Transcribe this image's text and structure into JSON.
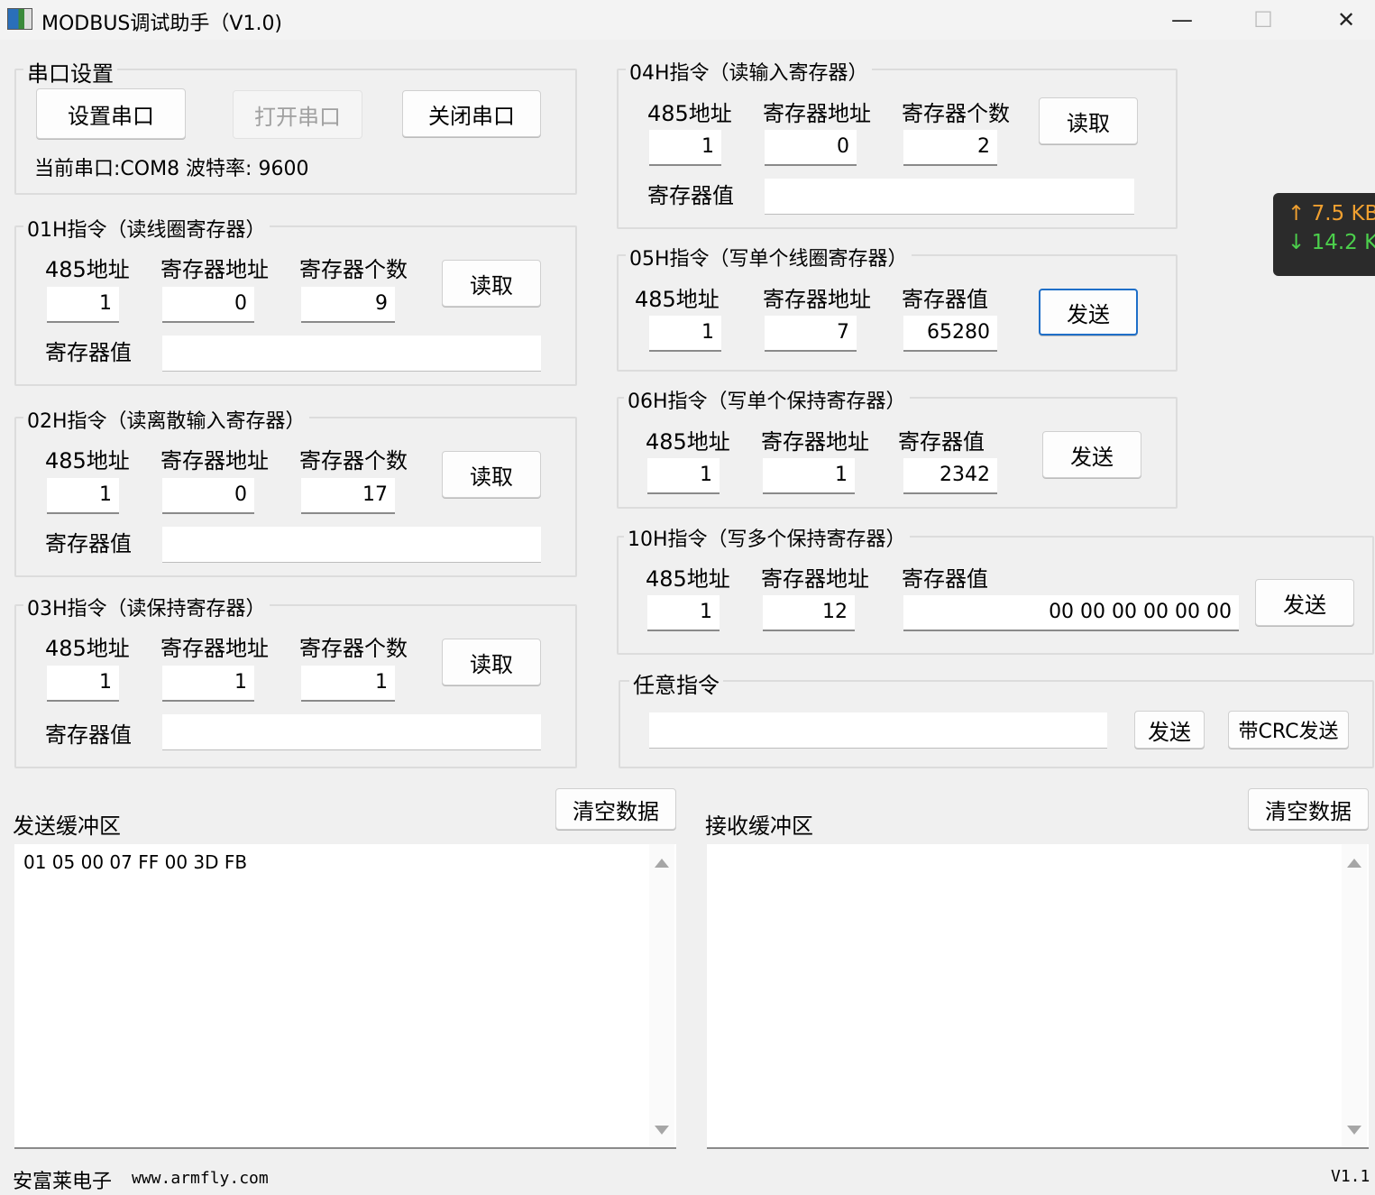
{
  "window": {
    "title": "MODBUS调试助手（V1.0)",
    "minimize": "—",
    "maximize": "☐",
    "close": "✕"
  },
  "serial": {
    "legend": "串口设置",
    "setup_btn": "设置串口",
    "open_btn": "打开串口",
    "close_btn": "关闭串口",
    "status": "当前串口:COM8 波特率: 9600"
  },
  "labels": {
    "addr485": "485地址",
    "reg_addr": "寄存器地址",
    "reg_count": "寄存器个数",
    "reg_value": "寄存器值",
    "read": "读取",
    "send": "发送"
  },
  "cmd01": {
    "legend": "01H指令（读线圈寄存器）",
    "addr": "1",
    "reg_addr": "0",
    "count": "9",
    "value": ""
  },
  "cmd02": {
    "legend": "02H指令（读离散输入寄存器）",
    "addr": "1",
    "reg_addr": "0",
    "count": "17",
    "value": ""
  },
  "cmd03": {
    "legend": "03H指令（读保持寄存器）",
    "addr": "1",
    "reg_addr": "1",
    "count": "1",
    "value": ""
  },
  "cmd04": {
    "legend": "04H指令（读输入寄存器）",
    "addr": "1",
    "reg_addr": "0",
    "count": "2",
    "value": ""
  },
  "cmd05": {
    "legend": "05H指令（写单个线圈寄存器）",
    "addr": "1",
    "reg_addr": "7",
    "value": "65280"
  },
  "cmd06": {
    "legend": "06H指令（写单个保持寄存器）",
    "addr": "1",
    "reg_addr": "1",
    "value": "2342"
  },
  "cmd10": {
    "legend": "10H指令（写多个保持寄存器）",
    "addr": "1",
    "reg_addr": "12",
    "value": "00 00 00 00 00 00"
  },
  "custom": {
    "legend": "任意指令",
    "value": "",
    "send_btn": "发送",
    "crc_btn": "带CRC发送"
  },
  "netmon": {
    "up": "↑ 7.5 KB",
    "down": "↓ 14.2 K",
    "up_color": "#f0a030",
    "down_color": "#4cd04c"
  },
  "send_buffer": {
    "label": "发送缓冲区",
    "clear_btn": "清空数据",
    "content": "01 05 00 07 FF 00 3D FB"
  },
  "recv_buffer": {
    "label": "接收缓冲区",
    "clear_btn": "清空数据",
    "content": ""
  },
  "footer": {
    "brand": "安富莱电子",
    "url": "www.armfly.com",
    "version": "V1.1"
  }
}
